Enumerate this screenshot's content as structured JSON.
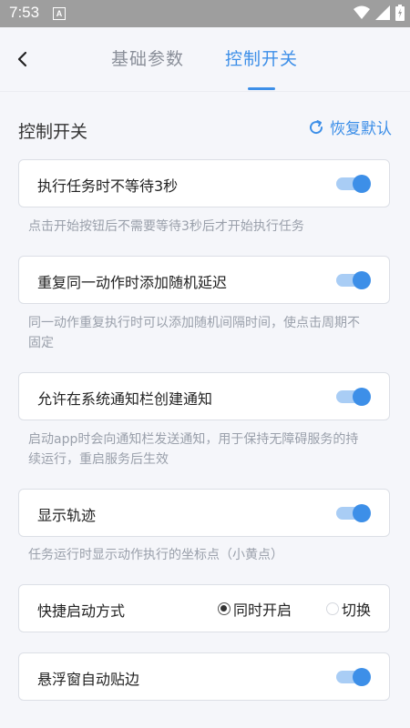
{
  "status_bar": {
    "time": "7:53",
    "notification_icon": "A"
  },
  "header": {
    "tabs": [
      "基础参数",
      "控制开关"
    ],
    "active_tab": 1
  },
  "section": {
    "title": "控制开关",
    "restore_label": "恢复默认"
  },
  "settings": [
    {
      "label": "执行任务时不等待3秒",
      "enabled": true,
      "desc": "点击开始按钮后不需要等待3秒后才开始执行任务"
    },
    {
      "label": "重复同一动作时添加随机延迟",
      "enabled": true,
      "desc_line1": "同一动作重复执行时可以添加随机间隔时间，使点击周期不",
      "desc_line2": "固定"
    },
    {
      "label": "允许在系统通知栏创建通知",
      "enabled": true,
      "desc_line1": "启动app时会向通知栏发送通知，用于保持无障碍服务的持",
      "desc_line2": "续运行，重启服务后生效"
    },
    {
      "label": "显示轨迹",
      "enabled": true,
      "desc": "任务运行时显示动作执行的坐标点（小黄点）"
    }
  ],
  "launch_mode": {
    "label": "快捷启动方式",
    "options": [
      "同时开启",
      "切换"
    ],
    "selected": 0
  },
  "float_snap": {
    "label": "悬浮窗自动贴边",
    "enabled": true
  },
  "colors": {
    "accent": "#3d8fe8",
    "toggle_track": "#a9cdf5",
    "desc_text": "#9aa0ab",
    "status_bar": "#9e9e9e"
  },
  "icons": [
    "notification-a-icon",
    "wifi-icon",
    "signal-icon",
    "battery-icon",
    "back-arrow-icon",
    "refresh-icon"
  ]
}
